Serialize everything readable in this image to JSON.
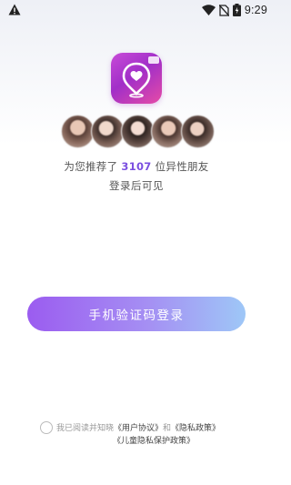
{
  "status_bar": {
    "time": "9:29",
    "icons": [
      "warning-icon",
      "wifi-icon",
      "no-sim-icon",
      "battery-icon"
    ]
  },
  "app": {
    "logo_icon": "location-heart-icon",
    "colors": {
      "accent": "#7b4fe0",
      "button_start": "#9b5cf0",
      "button_end": "#9ec7f7"
    }
  },
  "recommend": {
    "prefix": "为您推荐了",
    "count": "3107",
    "suffix": "位异性朋友",
    "after_login": "登录后可见"
  },
  "login": {
    "button_label": "手机验证码登录"
  },
  "agreement": {
    "prefix": "我已阅读并知晓",
    "user_agreement": "《用户协议》",
    "and": "和",
    "privacy_policy": "《隐私政策》",
    "children_privacy": "《儿童隐私保护政策》"
  }
}
